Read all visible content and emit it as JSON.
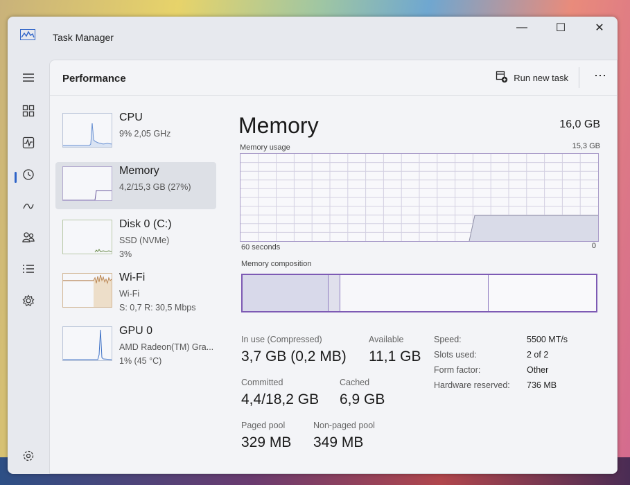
{
  "window": {
    "title": "Task Manager",
    "minimize": "—",
    "maximize": "☐",
    "close": "✕"
  },
  "rail": {
    "icons": [
      "hamburger-icon",
      "processes-icon",
      "performance-icon",
      "app-history-icon",
      "startup-apps-icon",
      "users-icon",
      "details-icon",
      "services-icon",
      "settings-icon"
    ]
  },
  "header": {
    "page_title": "Performance",
    "run_task_label": "Run new task",
    "more": "⋯"
  },
  "sidebar": {
    "items": [
      {
        "name": "CPU",
        "line1": "9% 2,05 GHz",
        "line2": ""
      },
      {
        "name": "Memory",
        "line1": "4,2/15,3 GB (27%)",
        "line2": ""
      },
      {
        "name": "Disk 0 (C:)",
        "line1": "SSD (NVMe)",
        "line2": "3%"
      },
      {
        "name": "Wi-Fi",
        "line1": "Wi-Fi",
        "line2": "S: 0,7  R: 30,5 Mbps"
      },
      {
        "name": "GPU 0",
        "line1": "AMD Radeon(TM) Gra...",
        "line2": "1% (45 °C)"
      }
    ]
  },
  "memory": {
    "title": "Memory",
    "total": "16,0 GB",
    "usage_label": "Memory usage",
    "usage_max": "15,3 GB",
    "axis_left": "60 seconds",
    "axis_right": "0",
    "composition_label": "Memory composition",
    "stats": {
      "in_use_label": "In use (Compressed)",
      "in_use_value": "3,7 GB (0,2 MB)",
      "available_label": "Available",
      "available_value": "11,1 GB",
      "committed_label": "Committed",
      "committed_value": "4,4/18,2 GB",
      "cached_label": "Cached",
      "cached_value": "6,9 GB",
      "paged_label": "Paged pool",
      "paged_value": "329 MB",
      "nonpaged_label": "Non-paged pool",
      "nonpaged_value": "349 MB"
    },
    "specs": [
      {
        "key": "Speed:",
        "value": "5500 MT/s"
      },
      {
        "key": "Slots used:",
        "value": "2 of 2"
      },
      {
        "key": "Form factor:",
        "value": "Other"
      },
      {
        "key": "Hardware reserved:",
        "value": "736 MB"
      }
    ]
  },
  "colors": {
    "accent": "#2f64c8",
    "memory_border": "#7d5ab4",
    "graph_fill": "#d9dbe8"
  }
}
